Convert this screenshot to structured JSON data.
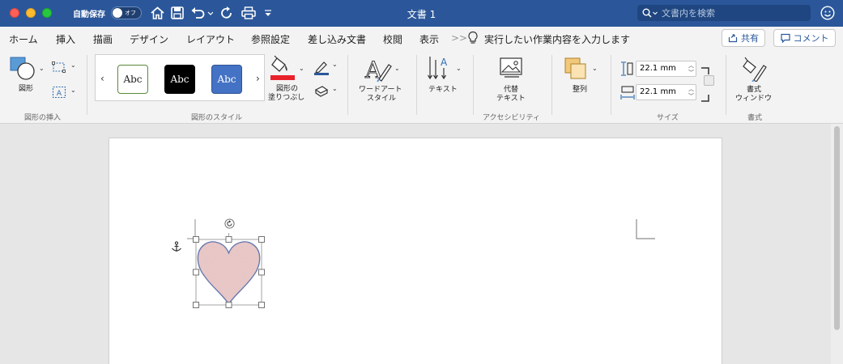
{
  "titlebar": {
    "autosave_label": "自動保存",
    "autosave_state": "オフ",
    "doc_title": "文書 1",
    "search_placeholder": "文書内を検索",
    "icons": [
      "home-icon",
      "save-icon",
      "undo-icon",
      "redo-icon",
      "print-icon",
      "customize-icon",
      "user-icon"
    ]
  },
  "tabs": [
    "ホーム",
    "挿入",
    "描画",
    "デザイン",
    "レイアウト",
    "参照設定",
    "差し込み文書",
    "校閲",
    "表示"
  ],
  "tellme": {
    "arrows": ">>",
    "text": "実行したい作業内容を入力します"
  },
  "share_label": "共有",
  "comment_label": "コメント",
  "ribbon": {
    "insert_shapes": {
      "shape_label": "図形",
      "group_label": "図形の挿入"
    },
    "shape_styles": {
      "swatches": [
        {
          "text": "Abc",
          "bg": "#ffffff",
          "border": "#5a8a3a",
          "fg": "#222222"
        },
        {
          "text": "Abc",
          "bg": "#000000",
          "border": "#000000",
          "fg": "#ffffff"
        },
        {
          "text": "Abc",
          "bg": "#4472c4",
          "border": "#2f5597",
          "fg": "#ffffff"
        }
      ],
      "fill_label_1": "図形の",
      "fill_label_2": "塗りつぶし",
      "fill_color": "#e8212a",
      "group_label": "図形のスタイル"
    },
    "wordart": {
      "label_1": "ワードアート",
      "label_2": "スタイル"
    },
    "text": {
      "label": "テキスト"
    },
    "accessibility": {
      "label_1": "代替",
      "label_2": "テキスト",
      "group_label": "アクセシビリティ"
    },
    "arrange": {
      "label": "整列"
    },
    "size": {
      "height": "22.1 mm",
      "width": "22.1 mm",
      "group_label": "サイズ"
    },
    "format": {
      "label_1": "書式",
      "label_2": "ウィンドウ",
      "group_label": "書式"
    }
  },
  "document": {
    "shape_name": "heart-shape",
    "heart_fill": "#e6c2c2",
    "heart_stroke": "#5b6fa8"
  }
}
